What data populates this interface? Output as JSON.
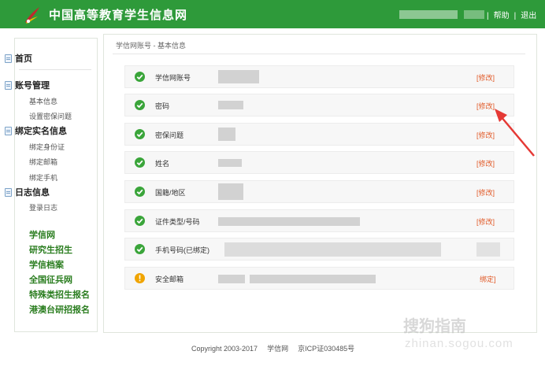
{
  "header": {
    "title": "中国高等教育学生信息网",
    "help_label": "帮助",
    "logout_label": "退出",
    "separator": "|"
  },
  "sidebar": {
    "home": "首页",
    "account_mgmt": "账号管理",
    "basic_info": "基本信息",
    "security_question": "设置密保问题",
    "bind_realname": "绑定实名信息",
    "bind_id": "绑定身份证",
    "bind_email": "绑定邮箱",
    "bind_phone": "绑定手机",
    "log_info": "日志信息",
    "login_log": "登录日志",
    "links": [
      "学信网",
      "研究生招生",
      "学信档案",
      "全国征兵网",
      "特殊类招生报名",
      "港澳台研招报名"
    ]
  },
  "breadcrumb": "学信网账号 - 基本信息",
  "rows": [
    {
      "label": "学信网账号",
      "action": "[修改]",
      "status": "ok"
    },
    {
      "label": "密码",
      "action": "[修改]",
      "status": "ok"
    },
    {
      "label": "密保问题",
      "action": "[修改]",
      "status": "ok"
    },
    {
      "label": "姓名",
      "action": "[修改]",
      "status": "ok"
    },
    {
      "label": "国籍/地区",
      "action": "[修改]",
      "status": "ok"
    },
    {
      "label": "证件类型/号码",
      "action": "[修改]",
      "status": "ok"
    },
    {
      "label": "手机号码(已绑定)",
      "action": "",
      "status": "ok"
    },
    {
      "label": "安全邮箱",
      "action": "绑定]",
      "status": "warn"
    }
  ],
  "footer": {
    "copyright": "Copyright 2003-2017",
    "site": "学信网",
    "icp": "京ICP证030485号"
  },
  "watermark": {
    "line1": "搜狗指南",
    "line2": "zhinan.sogou.com"
  },
  "colors": {
    "header_green": "#2e9a3a",
    "ok_green": "#3aa53a",
    "warn_orange": "#f0a400",
    "link_green": "#2a7d1f",
    "action_orange": "#e15a28",
    "arrow_red": "#e53935"
  }
}
